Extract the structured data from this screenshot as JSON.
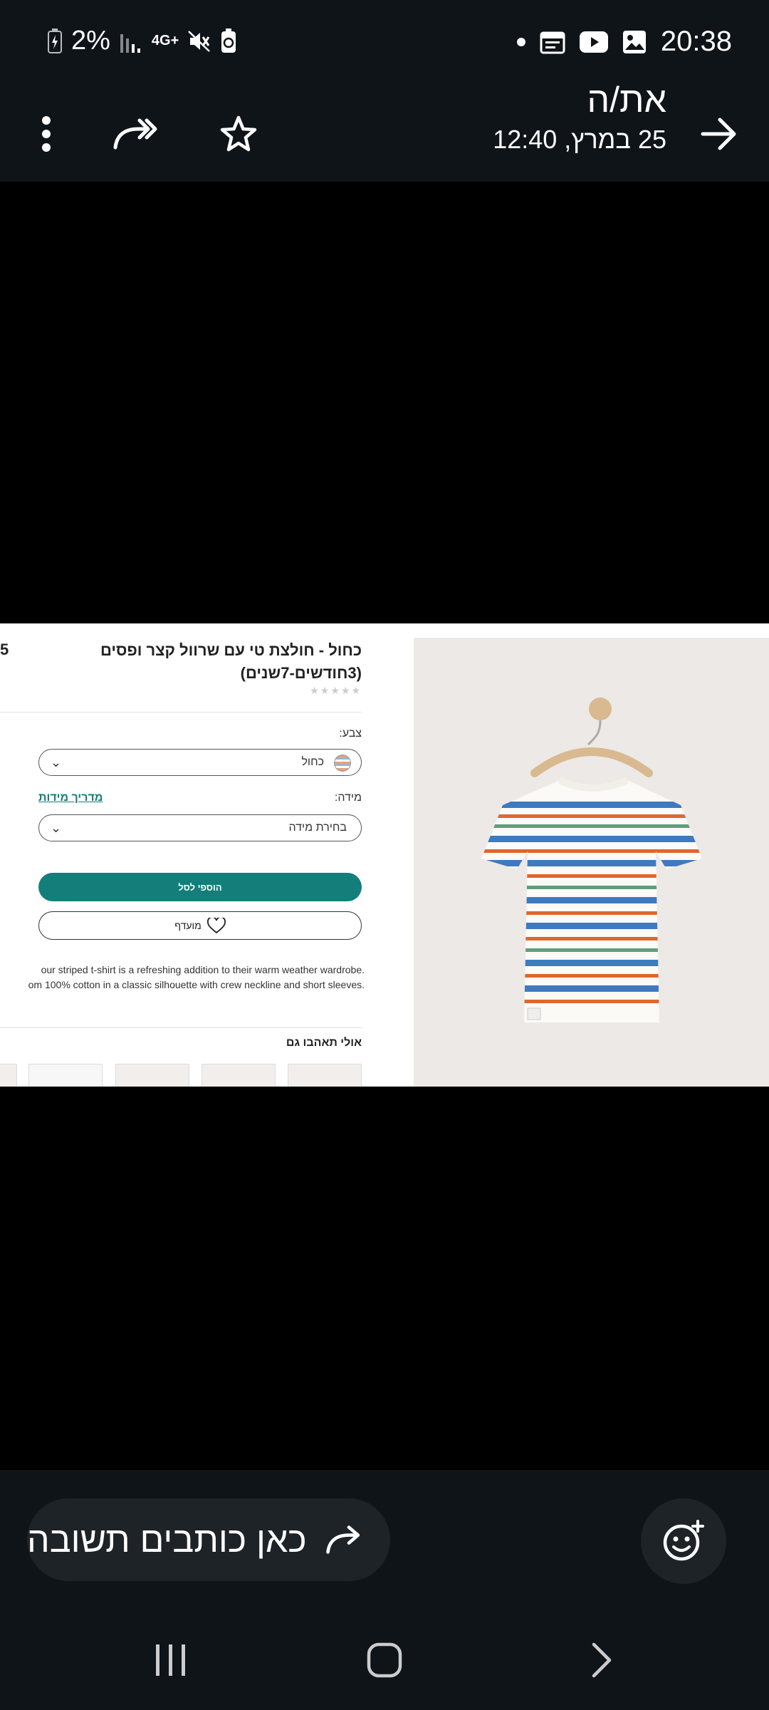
{
  "status_bar": {
    "battery": "2%",
    "network": "4G+",
    "time": "20:38",
    "icons": [
      "battery-charging-icon",
      "signal-icon",
      "network-4g-icon",
      "mute-vibrate-icon",
      "battery-saver-icon",
      "dot-icon",
      "calendar-icon",
      "youtube-icon",
      "gallery-icon"
    ]
  },
  "header": {
    "sender": "את/ה",
    "date": "25 במרץ, 12:40",
    "icons": [
      "back-arrow-icon",
      "star-icon",
      "forward-icon",
      "more-options-icon"
    ]
  },
  "shared_image": {
    "product": {
      "title": "כחול  - חולצת טי עם שרוול קצר ופסים (3חודשים-7שנים)",
      "price_fragment": "5",
      "rating_stars": "★★★★★",
      "color_label": "צבע:",
      "color_value": "כחול",
      "size_label": "מידה:",
      "size_guide": "מדריך מידות",
      "size_placeholder": "בחירת מידה",
      "add_to_cart": "הוספי לסל",
      "wishlist": "מועדף",
      "description_lines": [
        "our striped t-shirt is a refreshing addition to their warm weather wardrobe.",
        "om 100% cotton in a classic silhouette with crew neckline and short sleeves."
      ],
      "also_like": "אולי תאהבו גם"
    }
  },
  "reply_bar": {
    "placeholder": "כאן כותבים תשובה",
    "icons": [
      "reply-arrow-icon",
      "emoji-add-icon"
    ]
  },
  "nav_bar": {
    "icons": [
      "recents-icon",
      "home-icon",
      "back-icon"
    ]
  },
  "colors": {
    "bar_bg": "#0f1419",
    "reply_box_bg": "#1e2327",
    "teal_accent": "#137e7a"
  }
}
